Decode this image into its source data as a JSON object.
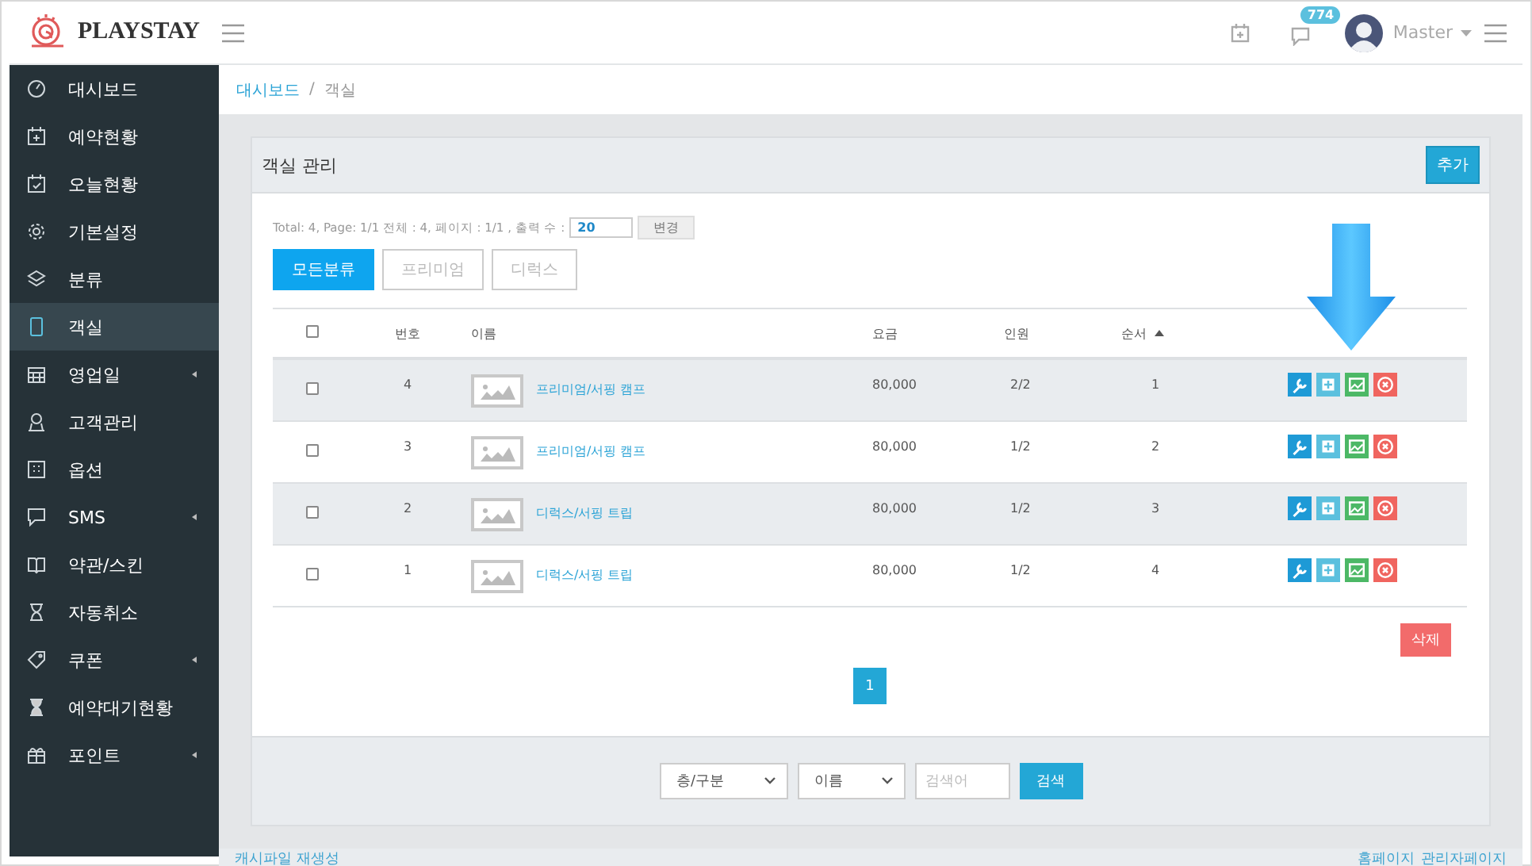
{
  "brand": {
    "name": "PLAYSTAY"
  },
  "topbar": {
    "badge": "774",
    "user": "Master"
  },
  "sidebar": {
    "items": [
      {
        "label": "대시보드",
        "selected": false,
        "has_submenu": false
      },
      {
        "label": "예약현황",
        "selected": false,
        "has_submenu": false
      },
      {
        "label": "오늘현황",
        "selected": false,
        "has_submenu": false
      },
      {
        "label": "기본설정",
        "selected": false,
        "has_submenu": false
      },
      {
        "label": "분류",
        "selected": false,
        "has_submenu": false
      },
      {
        "label": "객실",
        "selected": true,
        "has_submenu": false
      },
      {
        "label": "영업일",
        "selected": false,
        "has_submenu": true
      },
      {
        "label": "고객관리",
        "selected": false,
        "has_submenu": false
      },
      {
        "label": "옵션",
        "selected": false,
        "has_submenu": false
      },
      {
        "label": "SMS",
        "selected": false,
        "has_submenu": true
      },
      {
        "label": "약관/스킨",
        "selected": false,
        "has_submenu": false
      },
      {
        "label": "자동취소",
        "selected": false,
        "has_submenu": false
      },
      {
        "label": "쿠폰",
        "selected": false,
        "has_submenu": true
      },
      {
        "label": "예약대기현황",
        "selected": false,
        "has_submenu": false
      },
      {
        "label": "포인트",
        "selected": false,
        "has_submenu": true
      }
    ]
  },
  "breadcrumb": {
    "items": [
      "대시보드",
      "객실"
    ],
    "separator": "/"
  },
  "card": {
    "title": "객실 관리",
    "add_button": "추가",
    "summary": "Total: 4, Page: 1/1 전체 : 4, 페이지 : 1/1 , 출력 수 :",
    "per_page": "20",
    "change_button": "변경",
    "filters": [
      {
        "label": "모든분류",
        "selected": true
      },
      {
        "label": "프리미엄",
        "selected": false
      },
      {
        "label": "디럭스",
        "selected": false
      }
    ],
    "table": {
      "header_checked": false,
      "columns": [
        {
          "label": "번호",
          "sorted": false
        },
        {
          "label": "이름",
          "sorted": false
        },
        {
          "label": "요금",
          "sorted": false
        },
        {
          "label": "인원",
          "sorted": false
        },
        {
          "label": "순서",
          "sorted": true
        }
      ],
      "rows": [
        {
          "checked": false,
          "number": "4",
          "name": "프리미엄/서핑 캠프",
          "price": "80,000",
          "capacity": "2/2",
          "order": "1"
        },
        {
          "checked": false,
          "number": "3",
          "name": "프리미엄/서핑 캠프",
          "price": "80,000",
          "capacity": "1/2",
          "order": "2"
        },
        {
          "checked": false,
          "number": "2",
          "name": "디럭스/서핑 트립",
          "price": "80,000",
          "capacity": "1/2",
          "order": "3"
        },
        {
          "checked": false,
          "number": "1",
          "name": "디럭스/서핑 트립",
          "price": "80,000",
          "capacity": "1/2",
          "order": "4"
        }
      ]
    },
    "delete_button": "삭제",
    "pagination": [
      {
        "label": "1",
        "selected": true
      }
    ],
    "search": {
      "selects": [
        "층/구분",
        "이름"
      ],
      "placeholder": "검색어",
      "button": "검색"
    }
  },
  "footer": {
    "left_link": "캐시파일 재생성",
    "right_links": [
      "홈페이지",
      "관리자페이지"
    ]
  }
}
